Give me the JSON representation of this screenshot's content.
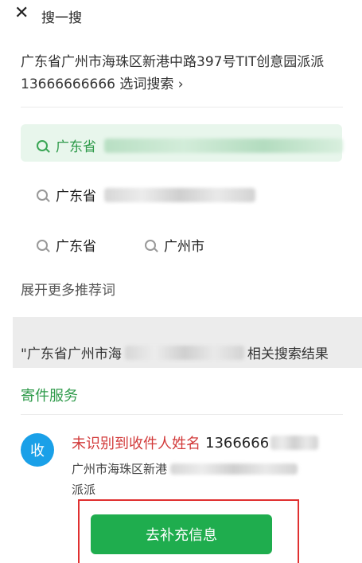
{
  "header": {
    "close_icon": "close-icon",
    "title": "搜一搜"
  },
  "query": {
    "text": "广东省广州市海珠区新港中路397号TIT创意园派派",
    "phone": "13666666666",
    "link_label": "选词搜索",
    "chevron": "›"
  },
  "suggestions": [
    {
      "prefix": "广东省",
      "highlighted": true
    },
    {
      "prefix": "广东省",
      "highlighted": false
    }
  ],
  "suggestion_chips": [
    {
      "label": "广东省"
    },
    {
      "label": "广州市"
    }
  ],
  "expand_label": "展开更多推荐词",
  "related": {
    "prefix": "\"广东省广州市海",
    "suffix": "相关搜索结果"
  },
  "service": {
    "title": "寄件服务",
    "avatar_label": "收",
    "error_text": "未识别到收件人姓名",
    "phone": "1366666",
    "address_line1": "广州市海珠区新港",
    "address_line2": "派派",
    "button_label": "去补充信息"
  },
  "colors": {
    "accent_green": "#1fad4e",
    "error_red": "#d23a3a",
    "avatar_blue": "#1aa0e8"
  }
}
